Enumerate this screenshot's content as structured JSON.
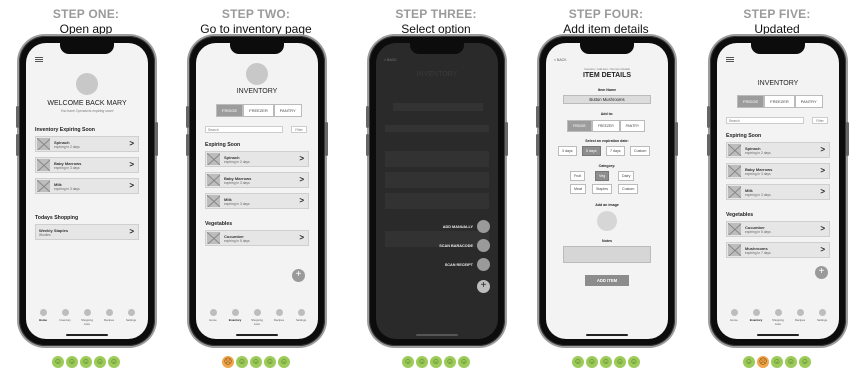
{
  "steps": [
    {
      "title": "STEP ONE:",
      "sub": "Open app"
    },
    {
      "title": "STEP TWO:",
      "sub": "Go to inventory page"
    },
    {
      "title": "STEP THREE:",
      "sub": "Select option"
    },
    {
      "title": "STEP FOUR:",
      "sub": "Add item details"
    },
    {
      "title": "STEP FIVE:",
      "sub": "Updated"
    }
  ],
  "s1": {
    "welcome": "WELCOME BACK MARY",
    "subtitle": "You have 3 products expiring soon!",
    "section1": "Inventory Expiring Soon",
    "items": [
      {
        "name": "Spinach",
        "sub": "expiring in 2 days"
      },
      {
        "name": "Baby Marrows",
        "sub": "expiring in 3 days"
      },
      {
        "name": "Milk",
        "sub": "expiring in 3 days"
      }
    ],
    "section2": "Todays Shopping",
    "shop": {
      "name": "Weekly Staples",
      "sub": "Woolies"
    }
  },
  "s2": {
    "title": "INVENTORY",
    "tabs": [
      "FRIDGE",
      "FREEZER",
      "PANTRY"
    ],
    "search": "Search",
    "filter": "Filter",
    "section1": "Expiring Soon",
    "items": [
      {
        "name": "Spinach",
        "sub": "expiring in 2 days"
      },
      {
        "name": "Baby Marrows",
        "sub": "expiring in 3 days"
      },
      {
        "name": "Milk",
        "sub": "expiring in 3 days"
      }
    ],
    "section2": "Vegetables",
    "veg": [
      {
        "name": "Cucumber",
        "sub": "expiring in 5 days"
      }
    ]
  },
  "s3": {
    "back": "< BACK",
    "options": [
      "ADD MANUALLY",
      "SCAN BARACODE",
      "SCAN RECEIPT"
    ]
  },
  "s4": {
    "back": "< BACK",
    "hint": "Inventory: Add item / Set item Details",
    "title": "ITEM DETAILS",
    "name_label": "Item Name",
    "name_value": "Button Mushrooms",
    "addto_label": "Add to:",
    "addto": [
      "FRIDGE",
      "FREEZER",
      "PANTRY"
    ],
    "exp_label": "Select an expiration date:",
    "exp": [
      "3 days",
      "5 days",
      "7 days",
      "Custom"
    ],
    "cat_label": "Category:",
    "cats": [
      "Fruit",
      "Veg",
      "Dairy",
      "Meat",
      "Staples",
      "Custom"
    ],
    "image_label": "Add an image",
    "notes_label": "Notes",
    "add_button": "ADD ITEM"
  },
  "s5": {
    "title": "INVENTORY",
    "tabs": [
      "FRIDGE",
      "FREEZER",
      "PANTRY"
    ],
    "search": "Search",
    "filter": "Filter",
    "section1": "Expiring Soon",
    "items": [
      {
        "name": "Spinach",
        "sub": "expiring in 2 days"
      },
      {
        "name": "Baby Marrows",
        "sub": "expiring in 3 days"
      },
      {
        "name": "Milk",
        "sub": "expiring in 3 days"
      }
    ],
    "section2": "Vegetables",
    "veg": [
      {
        "name": "Cucumber",
        "sub": "expiring in 5 days"
      },
      {
        "name": "Mushrooms",
        "sub": "expiring in 7 days"
      }
    ]
  },
  "nav": [
    "Home",
    "Inventory",
    "Shopping Lists",
    "Recipes",
    "Settings"
  ],
  "fab": "+",
  "chev": ">",
  "colors": {
    "happy": "#9ccb5a",
    "neutral": "#f0a64a",
    "dark_overlay": "#2a2a2a"
  }
}
